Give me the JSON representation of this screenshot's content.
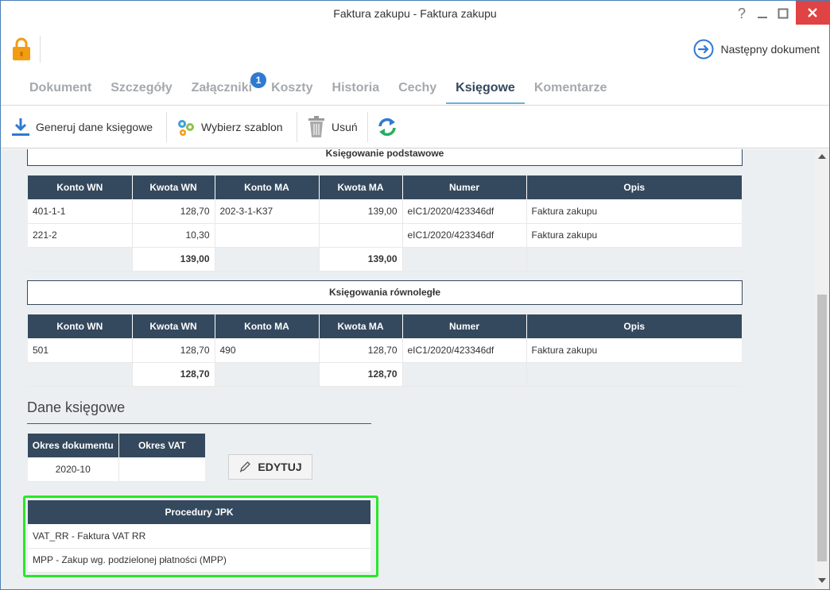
{
  "window": {
    "title": "Faktura zakupu - Faktura zakupu",
    "help": "?",
    "minimize": "—",
    "close": "✕"
  },
  "header": {
    "next_doc_label": "Następny dokument"
  },
  "tabs": [
    {
      "label": "Dokument"
    },
    {
      "label": "Szczegóły"
    },
    {
      "label": "Załączniki",
      "badge": "1"
    },
    {
      "label": "Koszty"
    },
    {
      "label": "Historia"
    },
    {
      "label": "Cechy"
    },
    {
      "label": "Księgowe",
      "active": true
    },
    {
      "label": "Komentarze"
    }
  ],
  "toolbar": {
    "generate_label": "Generuj dane księgowe",
    "template_label": "Wybierz szablon",
    "delete_label": "Usuń"
  },
  "colors": {
    "header_dark": "#34495e",
    "accent_blue": "#2f7ad1",
    "highlight_green": "#27e827",
    "close_red": "#e04343"
  },
  "ksiegowanie_podstawowe": {
    "title": "Księgowanie podstawowe",
    "columns": [
      "Konto WN",
      "Kwota WN",
      "Konto MA",
      "Kwota MA",
      "Numer",
      "Opis"
    ],
    "rows": [
      [
        "401-1-1",
        "128,70",
        "202-3-1-K37",
        "139,00",
        "eIC1/2020/423346df",
        "Faktura zakupu"
      ],
      [
        "221-2",
        "10,30",
        "",
        "",
        "eIC1/2020/423346df",
        "Faktura zakupu"
      ]
    ],
    "sum_wn": "139,00",
    "sum_ma": "139,00"
  },
  "ksiegowania_rownolegle": {
    "title": "Księgowania równoległe",
    "columns": [
      "Konto WN",
      "Kwota WN",
      "Konto MA",
      "Kwota MA",
      "Numer",
      "Opis"
    ],
    "rows": [
      [
        "501",
        "128,70",
        "490",
        "128,70",
        "eIC1/2020/423346df",
        "Faktura zakupu"
      ]
    ],
    "sum_wn": "128,70",
    "sum_ma": "128,70"
  },
  "dane_ksiegowe": {
    "title": "Dane księgowe",
    "columns": [
      "Okres dokumentu",
      "Okres VAT"
    ],
    "okres_dokumentu": "2020-10",
    "okres_vat": "",
    "edit_label": "EDYTUJ"
  },
  "procedury_jpk": {
    "title": "Procedury JPK",
    "items": [
      "VAT_RR - Faktura VAT RR",
      "MPP - Zakup wg. podzielonej płatności (MPP)"
    ]
  }
}
